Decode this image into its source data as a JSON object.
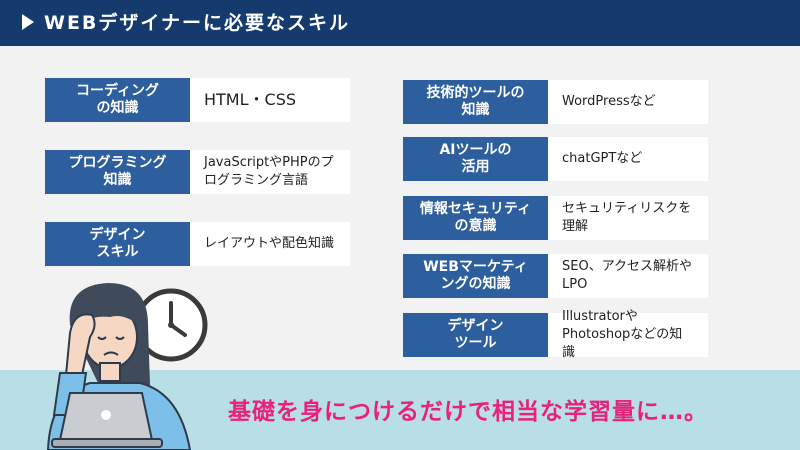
{
  "header": {
    "title": "WEBデザイナーに必要なスキル"
  },
  "skills_left": [
    {
      "label": "コーディング\nの知識",
      "value": "HTML・CSS"
    },
    {
      "label": "プログラミング\n知識",
      "value": "JavaScriptやPHPのプ\nログラミング言語"
    },
    {
      "label": "デザイン\nスキル",
      "value": "レイアウトや配色知識"
    }
  ],
  "skills_right": [
    {
      "label": "技術的ツールの\n知識",
      "value": "WordPressなど"
    },
    {
      "label": "AIツールの\n活用",
      "value": "chatGPTなど"
    },
    {
      "label": "情報セキュリティ\nの意識",
      "value": "セキュリティリスクを\n理解"
    },
    {
      "label": "WEBマーケティ\nングの知識",
      "value": "SEO、アクセス解析や\nLPO"
    },
    {
      "label": "デザイン\nツール",
      "value": "Illustratorや\nPhotoshopなどの知識"
    }
  ],
  "tagline": "基礎を身につけるだけで相当な学習量に…。",
  "colors": {
    "header_bg": "#143a6e",
    "label_bg": "#2d5e9e",
    "band_bg": "#b9dfe6",
    "tagline": "#e8217d"
  },
  "icons": [
    "play-triangle-icon",
    "clock-icon",
    "stressed-person-illustration",
    "laptop-icon"
  ]
}
